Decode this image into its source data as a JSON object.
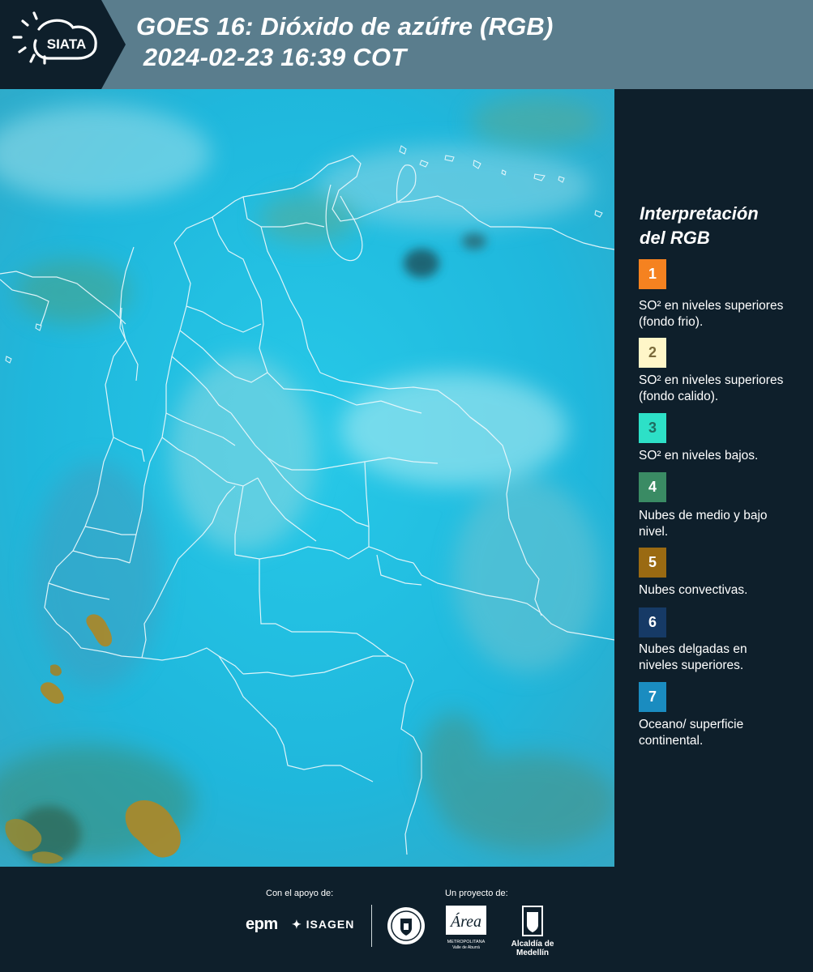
{
  "header": {
    "logo_text": "SIATA",
    "title_line1": "GOES 16: Dióxido de azúfre (RGB)",
    "title_line2": " 2024-02-23 16:39 COT"
  },
  "map": {
    "icon": "satellite-image-colombia"
  },
  "legend": {
    "title_line1": "Interpretación",
    "title_line2": "del RGB",
    "items": [
      {
        "number": "1",
        "color": "#f58220",
        "text_color": "#ffffff",
        "label": "SO² en niveles superiores (fondo frio)."
      },
      {
        "number": "2",
        "color": "#fff6c8",
        "text_color": "#7a6a3a",
        "label": "SO² en niveles superiores (fondo calido)."
      },
      {
        "number": "3",
        "color": "#2de0c7",
        "text_color": "#1f6b60",
        "label": "SO² en niveles bajos."
      },
      {
        "number": "4",
        "color": "#3a8b64",
        "text_color": "#ffffff",
        "label": "Nubes de medio y bajo nivel."
      },
      {
        "number": "5",
        "color": "#9a6a12",
        "text_color": "#ffffff",
        "label": "Nubes convectivas."
      },
      {
        "number": "6",
        "color": "#163a66",
        "text_color": "#ffffff",
        "label": "Nubes delgadas en niveles superiores."
      },
      {
        "number": "7",
        "color": "#1a8cc0",
        "text_color": "#ffffff",
        "label": "Oceano/ superficie continental."
      }
    ]
  },
  "footer": {
    "support_label": "Con el apoyo de:",
    "project_label": "Un proyecto de:",
    "sponsor1": "epm",
    "sponsor2": "ISAGEN",
    "sponsor4_line1": "METROPOLITANA",
    "sponsor4_line2": "Valle de Aburrá",
    "sponsor5": "Alcaldía de Medellín"
  }
}
